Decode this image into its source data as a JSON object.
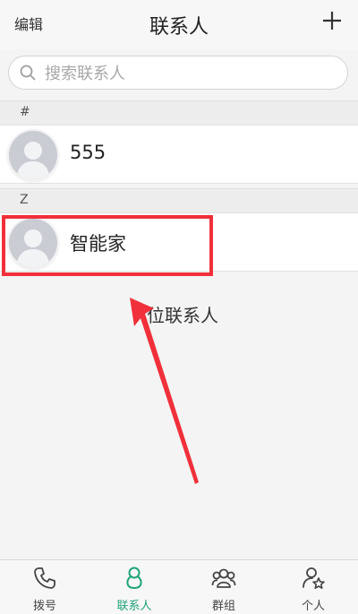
{
  "header": {
    "edit_label": "编辑",
    "title": "联系人",
    "add_icon": "plus-icon"
  },
  "search": {
    "placeholder": "搜索联系人",
    "icon": "search-icon"
  },
  "sections": [
    {
      "letter": "#",
      "contacts": [
        {
          "name": "555"
        }
      ]
    },
    {
      "letter": "Z",
      "contacts": [
        {
          "name": "智能家"
        }
      ]
    }
  ],
  "footer_count_text": "位联系人",
  "annotation": {
    "color": "#f0303a"
  },
  "bottom_nav": {
    "items": [
      {
        "label": "拨号",
        "icon": "phone-icon",
        "active": false
      },
      {
        "label": "联系人",
        "icon": "contact-person-icon",
        "active": true
      },
      {
        "label": "群组",
        "icon": "group-icon",
        "active": false
      },
      {
        "label": "个人",
        "icon": "profile-star-icon",
        "active": false
      }
    ],
    "active_color": "#1fa37a"
  }
}
